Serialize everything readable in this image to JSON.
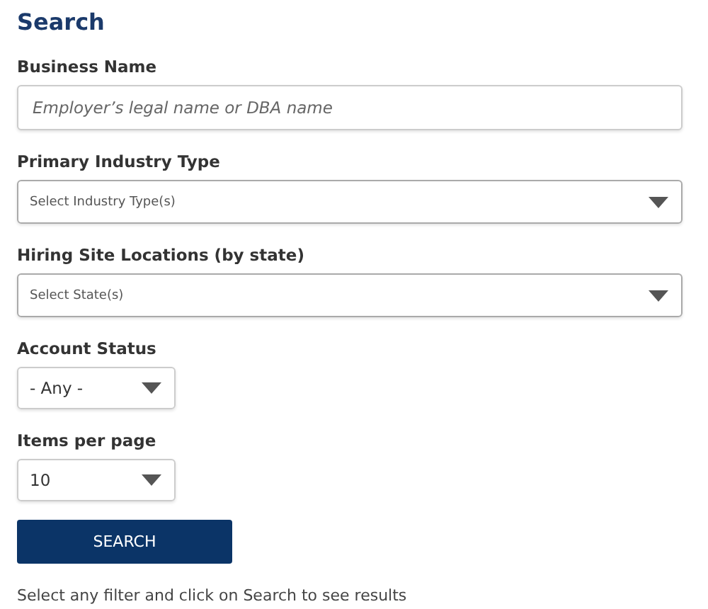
{
  "heading": "Search",
  "fields": [
    {
      "label": "Business Name",
      "kind": "text",
      "placeholder": "Employer’s legal name or DBA name"
    },
    {
      "label": "Primary Industry Type",
      "kind": "multiselect",
      "placeholder": "Select Industry Type(s)"
    },
    {
      "label": "Hiring Site Locations (by state)",
      "kind": "multiselect",
      "placeholder": "Select State(s)"
    },
    {
      "label": "Account Status",
      "kind": "select",
      "value": "- Any -"
    },
    {
      "label": "Items per page",
      "kind": "select",
      "value": "10"
    }
  ],
  "button": "SEARCH",
  "hint": "Select any filter and click on Search to see results"
}
